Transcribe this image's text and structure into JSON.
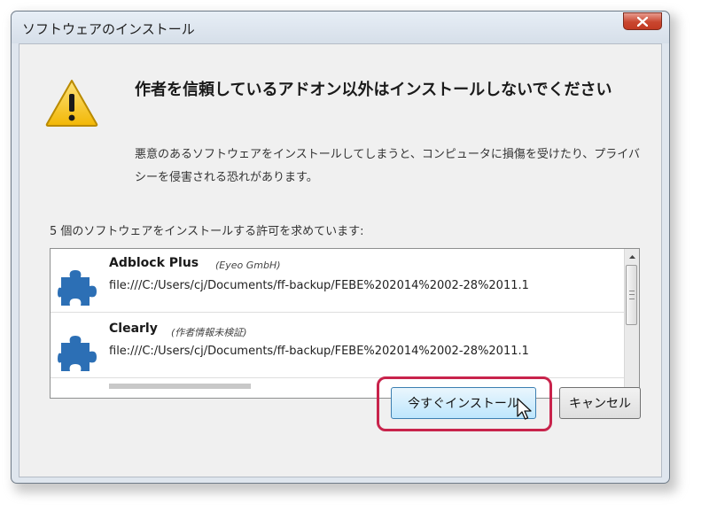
{
  "window": {
    "title": "ソフトウェアのインストール",
    "close_label": "x"
  },
  "warning": {
    "heading": "作者を信頼しているアドオン以外はインストールしないでください",
    "description": "悪意のあるソフトウェアをインストールしてしまうと、コンピュータに損傷を受けたり、プライバシーを侵害される恐れがあります。"
  },
  "prompt": "5 個のソフトウェアをインストールする許可を求めています:",
  "addons": [
    {
      "name": "Adblock Plus",
      "author": "(Eyeo GmbH)",
      "path": "file:///C:/Users/cj/Documents/ff-backup/FEBE%202014%2002-28%2011.1"
    },
    {
      "name": "Clearly",
      "author": "(作者情報未検証)",
      "path": "file:///C:/Users/cj/Documents/ff-backup/FEBE%202014%2002-28%2011.1"
    }
  ],
  "buttons": {
    "install": "今すぐインストール",
    "cancel": "キャンセル"
  },
  "colors": {
    "highlight": "#c8234b",
    "puzzle": "#2c6fb5",
    "warning": "#f6c21b",
    "close": "#c9462f"
  },
  "icons": {
    "warning": "warning-icon",
    "addon": "puzzle-icon",
    "close": "close-icon",
    "cursor": "mouse-pointer-icon"
  }
}
